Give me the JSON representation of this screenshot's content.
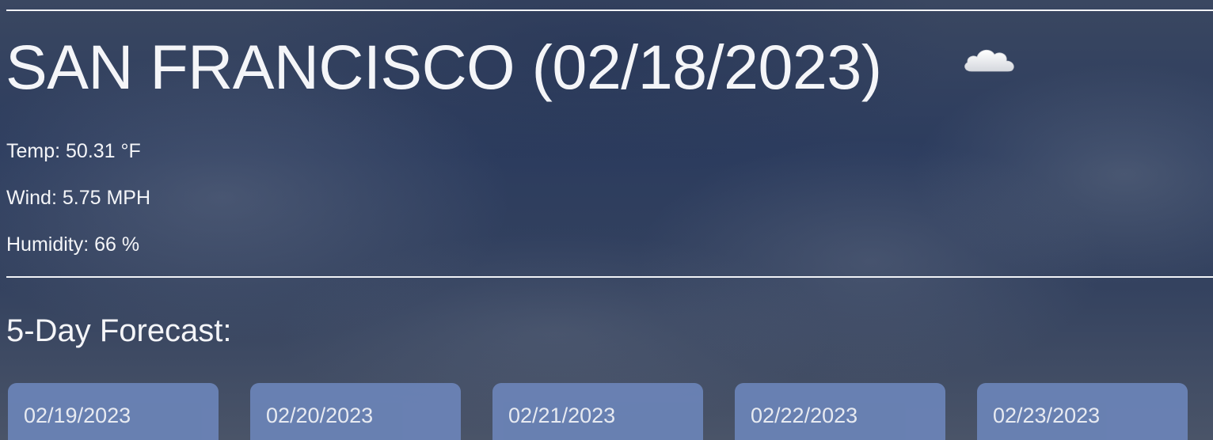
{
  "current": {
    "title": "SAN FRANCISCO (02/18/2023)",
    "icon": "cloud-icon",
    "temp": "Temp: 50.31 °F",
    "wind": "Wind: 5.75 MPH",
    "humidity": "Humidity: 66 %"
  },
  "forecast": {
    "heading": "5-Day Forecast:",
    "days": [
      {
        "date": "02/19/2023"
      },
      {
        "date": "02/20/2023"
      },
      {
        "date": "02/21/2023"
      },
      {
        "date": "02/22/2023"
      },
      {
        "date": "02/23/2023"
      }
    ]
  },
  "colors": {
    "card_background": "#6a82b5",
    "text": "#f4f5f8",
    "rule": "#f1f3f7"
  }
}
